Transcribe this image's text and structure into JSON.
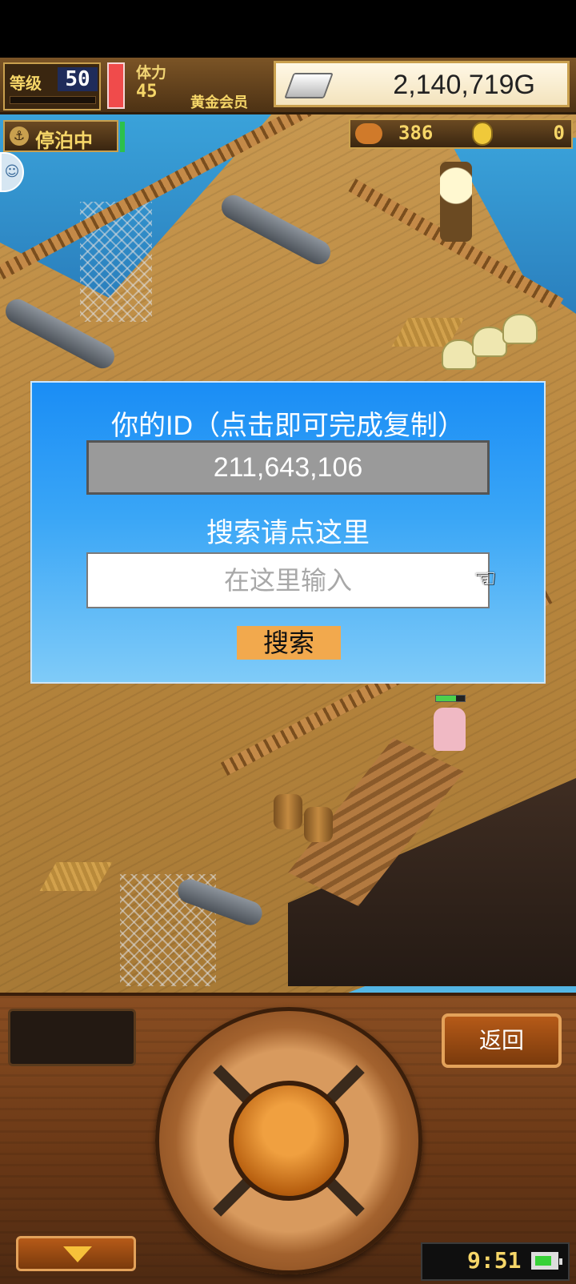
{
  "hud": {
    "level_label": "等级",
    "level_value": "50",
    "stamina_label": "体力",
    "stamina_value": "45",
    "member_badge": "黄金会员",
    "gold": "2,140,719G",
    "docked_status": "停泊中",
    "food": "386",
    "coins": "0"
  },
  "dialog": {
    "title": "你的ID（点击即可完成复制）",
    "user_id": "211,643,106",
    "search_prompt": "搜索请点这里",
    "input_placeholder": "在这里输入",
    "search_button": "搜索"
  },
  "controls": {
    "back_button": "返回",
    "clock": "9:51"
  },
  "icons": {
    "gold": "silver-ingot-icon",
    "food": "meat-icon",
    "coin": "medal-coin-icon",
    "pointer": "pointing-hand-icon",
    "collapse": "chevron-down-icon",
    "battery": "battery-icon"
  },
  "colors": {
    "dialog_gradient_top": "#1a8df5",
    "dialog_gradient_bottom": "#7fcbf8",
    "search_button": "#f2a94d",
    "id_box": "#9a9a9a",
    "hud_text": "#f6d668"
  }
}
